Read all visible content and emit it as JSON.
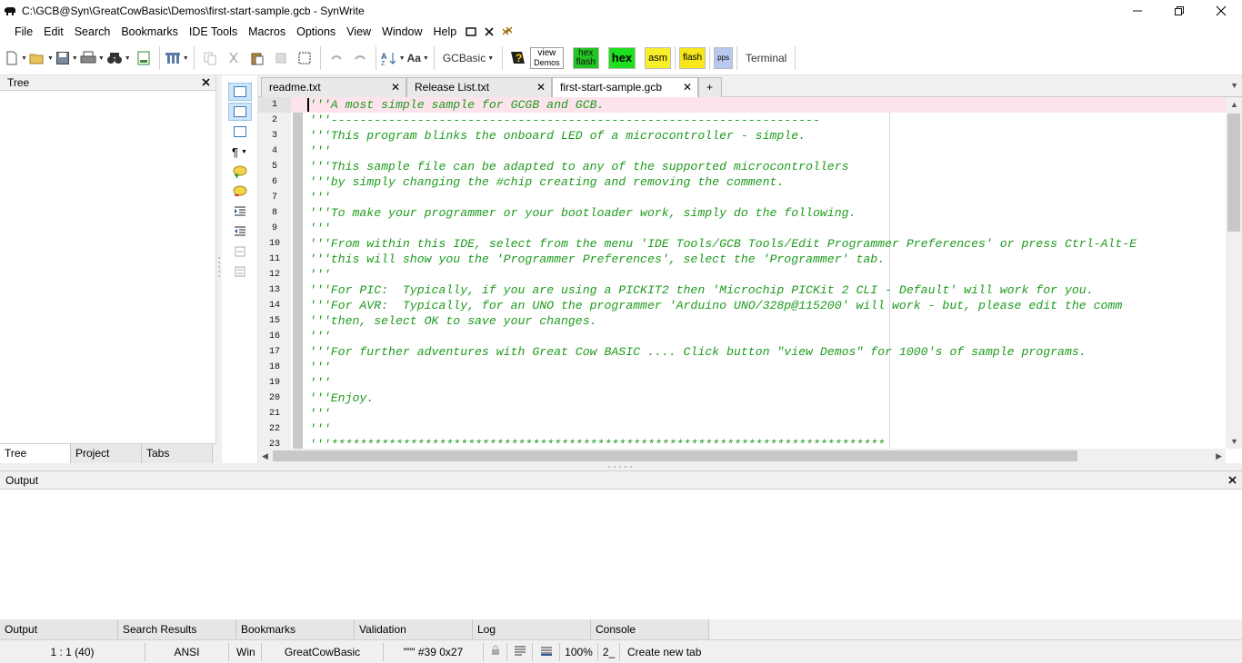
{
  "window": {
    "title": "C:\\GCB@Syn\\GreatCowBasic\\Demos\\first-start-sample.gcb - SynWrite"
  },
  "menu": [
    "File",
    "Edit",
    "Search",
    "Bookmarks",
    "IDE Tools",
    "Macros",
    "Options",
    "View",
    "Window",
    "Help"
  ],
  "toolbar": {
    "lexer_label": "GCBasic",
    "view_demos_line1": "view",
    "view_demos_line2": "Demos",
    "hex_flash_line1": "hex",
    "hex_flash_line2": "flash",
    "hex_label": "hex",
    "asm_label": "asm",
    "flash_label": "flash",
    "pps_label": "pps",
    "terminal_label": "Terminal",
    "colors": {
      "hex_flash": "#22c322",
      "hex": "#1ee01e",
      "asm": "#f7ef2a",
      "flash": "#f7e61c",
      "pps": "#b9c8ef"
    }
  },
  "left_panel": {
    "title": "Tree",
    "tabs": [
      "Tree",
      "Project",
      "Tabs"
    ]
  },
  "editor": {
    "tabs": [
      "readme.txt",
      "Release List.txt",
      "first-start-sample.gcb"
    ],
    "add_tab_label": "+",
    "active_line": 1,
    "lines": [
      {
        "n": "1",
        "text": "'''A most simple sample for GCGB and GCB."
      },
      {
        "n": "2",
        "text": "'''--------------------------------------------------------------------"
      },
      {
        "n": "3",
        "text": "'''This program blinks the onboard LED of a microcontroller - simple."
      },
      {
        "n": "4",
        "text": "'''"
      },
      {
        "n": "5",
        "text": "'''This sample file can be adapted to any of the supported microcontrollers"
      },
      {
        "n": "6",
        "text": "'''by simply changing the #chip creating and removing the comment."
      },
      {
        "n": "7",
        "text": "'''"
      },
      {
        "n": "8",
        "text": "'''To make your programmer or your bootloader work, simply do the following."
      },
      {
        "n": "9",
        "text": "'''"
      },
      {
        "n": "10",
        "text": "'''From within this IDE, select from the menu 'IDE Tools/GCB Tools/Edit Programmer Preferences' or press Ctrl-Alt-E"
      },
      {
        "n": "11",
        "text": "'''this will show you the 'Programmer Preferences', select the 'Programmer' tab."
      },
      {
        "n": "12",
        "text": "'''"
      },
      {
        "n": "13",
        "text": "'''For PIC:  Typically, if you are using a PICKIT2 then 'Microchip PICKit 2 CLI - Default' will work for you."
      },
      {
        "n": "14",
        "text": "'''For AVR:  Typically, for an UNO the programmer 'Arduino UNO/328p@115200' will work - but, please edit the comm"
      },
      {
        "n": "15",
        "text": "'''then, select OK to save your changes."
      },
      {
        "n": "16",
        "text": "'''"
      },
      {
        "n": "17",
        "text": "'''For further adventures with Great Cow BASIC .... Click button \"view Demos\" for 1000's of sample programs."
      },
      {
        "n": "18",
        "text": "'''"
      },
      {
        "n": "19",
        "text": "'''"
      },
      {
        "n": "20",
        "text": "'''Enjoy."
      },
      {
        "n": "21",
        "text": "'''"
      },
      {
        "n": "22",
        "text": "'''"
      },
      {
        "n": "23",
        "text": "'''*****************************************************************************"
      }
    ]
  },
  "output_panel": {
    "title": "Output",
    "tabs": [
      "Output",
      "Search Results",
      "Bookmarks",
      "Validation",
      "Log",
      "Console"
    ]
  },
  "status_bar": {
    "position": "1 : 1 (40)",
    "encoding": "ANSI",
    "line_ending": "Win",
    "lexer": "GreatCowBasic",
    "char_info": "\"\"\" #39 0x27",
    "zoom": "100%",
    "col_marker": "2_",
    "hint": "Create new tab"
  }
}
